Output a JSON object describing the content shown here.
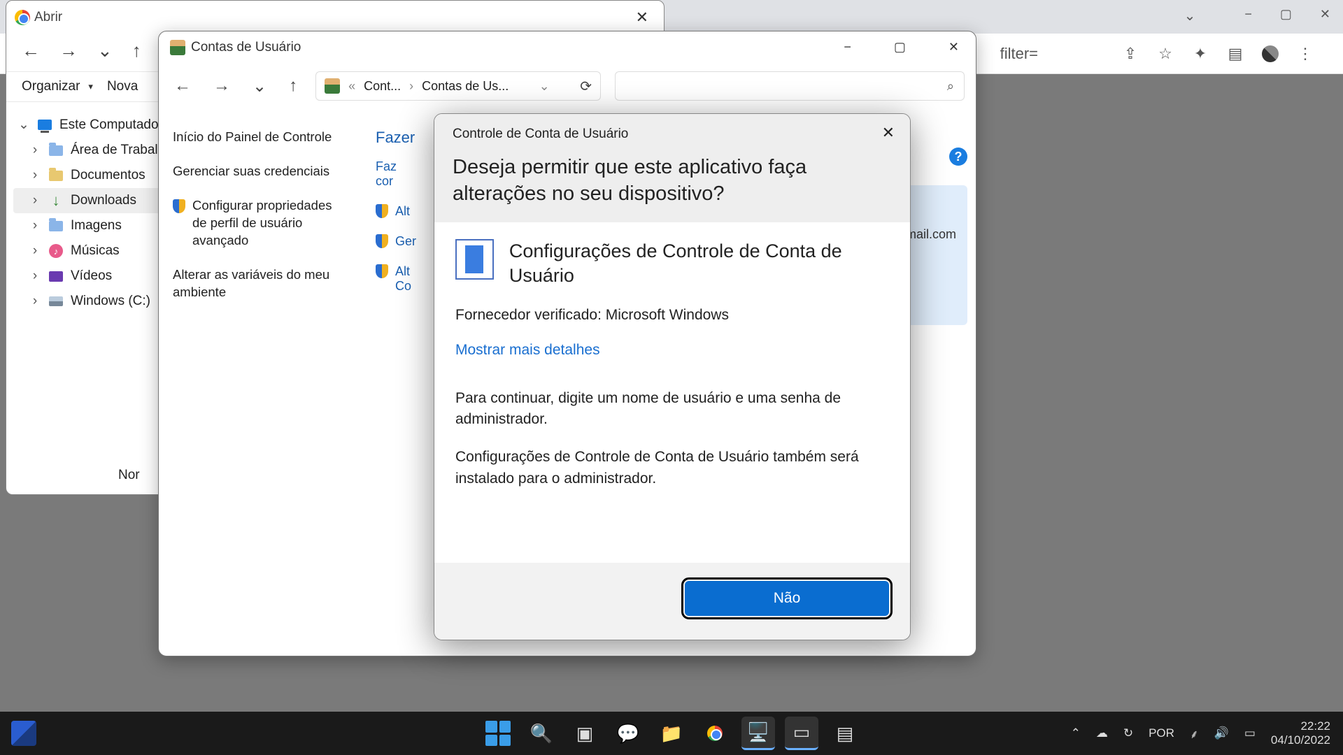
{
  "chrome": {
    "address_fragment": "filter=",
    "caption_min": "−",
    "caption_max": "▢",
    "caption_close": "✕",
    "caption_chevron": "⌄"
  },
  "abrir": {
    "title": "Abrir",
    "close": "✕",
    "nav_back": "←",
    "nav_fwd": "→",
    "nav_chev": "⌄",
    "nav_up": "↑",
    "toolbar_organize": "Organizar",
    "toolbar_caret": "▾",
    "toolbar_new": "Nova",
    "tree": [
      {
        "exp": "⌄",
        "icon": "computer",
        "label": "Este Computado"
      },
      {
        "exp": "›",
        "icon": "folder-blue",
        "label": "Área de Trabalh"
      },
      {
        "exp": "›",
        "icon": "folder",
        "label": "Documentos"
      },
      {
        "exp": "›",
        "icon": "download",
        "label": "Downloads",
        "sel": true
      },
      {
        "exp": "›",
        "icon": "folder-blue",
        "label": "Imagens"
      },
      {
        "exp": "›",
        "icon": "music",
        "label": "Músicas"
      },
      {
        "exp": "›",
        "icon": "video",
        "label": "Vídeos"
      },
      {
        "exp": "›",
        "icon": "drive",
        "label": "Windows (C:)"
      }
    ],
    "footer_label": "Nor"
  },
  "contas": {
    "title": "Contas de Usuário",
    "caption_min": "−",
    "caption_max": "▢",
    "caption_close": "✕",
    "nav_back": "←",
    "nav_fwd": "→",
    "nav_chev": "⌄",
    "nav_up": "↑",
    "crumb_sep1": "«",
    "crumb1": "Cont...",
    "crumb_sep2": "›",
    "crumb2": "Contas de Us...",
    "crumb_chev": "⌄",
    "refresh": "⟳",
    "search_icon": "⌕",
    "side": {
      "home": "Início do Painel de Controle",
      "creds": "Gerenciar suas credenciais",
      "profile": "Configurar propriedades de perfil de usuário avançado",
      "env": "Alterar as variáveis do meu ambiente"
    },
    "main_head": "Fazer",
    "links": {
      "l1": "Faz\ncor",
      "l2": "Alt",
      "l3": "Ger",
      "l4": "Alt\nCo"
    },
    "user_email": "mail.com",
    "help": "?"
  },
  "uac": {
    "small_title": "Controle de Conta de Usuário",
    "close": "✕",
    "ask": "Deseja permitir que este aplicativo faça alterações no seu dispositivo?",
    "app_name": "Configurações de Controle de Conta de Usuário",
    "vendor": "Fornecedor verificado: Microsoft Windows",
    "more": "Mostrar mais detalhes",
    "msg1": "Para continuar, digite um nome de usuário e uma senha de administrador.",
    "msg2": "Configurações de Controle de Conta de Usuário também será instalado para o administrador.",
    "no": "Não"
  },
  "taskbar": {
    "tray_chev": "⌃",
    "lang": "POR",
    "time": "22:22",
    "date": "04/10/2022"
  }
}
